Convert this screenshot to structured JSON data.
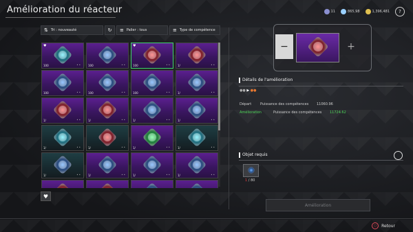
{
  "header": {
    "title": "Amélioration du réacteur",
    "currencies": [
      {
        "icon": "coin-icon",
        "value": "11",
        "color": "#8a8fd0"
      },
      {
        "icon": "crystal-icon",
        "value": "865,98",
        "color": "#9ad0ff"
      },
      {
        "icon": "gold-icon",
        "value": "1,396,481",
        "color": "#e0c050"
      }
    ],
    "help_label": "?"
  },
  "toolbar": {
    "sort_label": "Tri : nouveauté",
    "tier_label": "Palier : tous",
    "type_label": "Type de compétence"
  },
  "grid": {
    "items": [
      {
        "bg": "purple",
        "core": "cyan",
        "fav": true,
        "level": "100"
      },
      {
        "bg": "purple",
        "core": "blue",
        "fav": false,
        "level": "100"
      },
      {
        "bg": "purple",
        "core": "red",
        "fav": true,
        "level": "100",
        "selected": true
      },
      {
        "bg": "purple",
        "core": "red",
        "fav": false,
        "level": "1/"
      },
      {
        "bg": "purple",
        "core": "blue",
        "fav": false,
        "level": "100"
      },
      {
        "bg": "purple",
        "core": "blue",
        "fav": false,
        "level": "100"
      },
      {
        "bg": "purple",
        "core": "blue",
        "fav": false,
        "level": "100"
      },
      {
        "bg": "purple",
        "core": "blue",
        "fav": false,
        "level": "1/"
      },
      {
        "bg": "purple",
        "core": "red",
        "fav": false,
        "level": "1/"
      },
      {
        "bg": "purple",
        "core": "red",
        "fav": false,
        "level": "1/"
      },
      {
        "bg": "purple",
        "core": "blue",
        "fav": false,
        "level": "1/"
      },
      {
        "bg": "purple",
        "core": "blue",
        "fav": false,
        "level": "1/"
      },
      {
        "bg": "teal",
        "core": "cyan",
        "fav": false,
        "level": "1/"
      },
      {
        "bg": "teal",
        "core": "red",
        "fav": false,
        "level": "1/"
      },
      {
        "bg": "purple",
        "core": "green",
        "fav": false,
        "level": "1/"
      },
      {
        "bg": "teal",
        "core": "cyan",
        "fav": false,
        "level": "1/"
      },
      {
        "bg": "teal",
        "core": "blue",
        "fav": false,
        "level": "1/"
      },
      {
        "bg": "purple",
        "core": "blue",
        "fav": false,
        "level": "1/"
      },
      {
        "bg": "purple",
        "core": "blue",
        "fav": false,
        "level": "1/"
      },
      {
        "bg": "purple",
        "core": "blue",
        "fav": false,
        "level": "1/"
      },
      {
        "bg": "purple",
        "core": "red",
        "fav": false,
        "level": ""
      },
      {
        "bg": "purple",
        "core": "red",
        "fav": false,
        "level": ""
      },
      {
        "bg": "purple",
        "core": "blue",
        "fav": false,
        "level": ""
      },
      {
        "bg": "purple",
        "core": "blue",
        "fav": false,
        "level": ""
      }
    ]
  },
  "details": {
    "title": "Détails de l'amélioration",
    "start_label": "Départ",
    "start_stat": "Puissance des compétences",
    "start_value": "11060.96",
    "upgrade_label": "Amélioration",
    "upgrade_stat": "Puissance des compétences",
    "upgrade_value": "11724.62"
  },
  "required": {
    "title": "Objet requis",
    "have": "1",
    "need": "80"
  },
  "upgrade_button": "Amélioration",
  "back_label": "Retour"
}
